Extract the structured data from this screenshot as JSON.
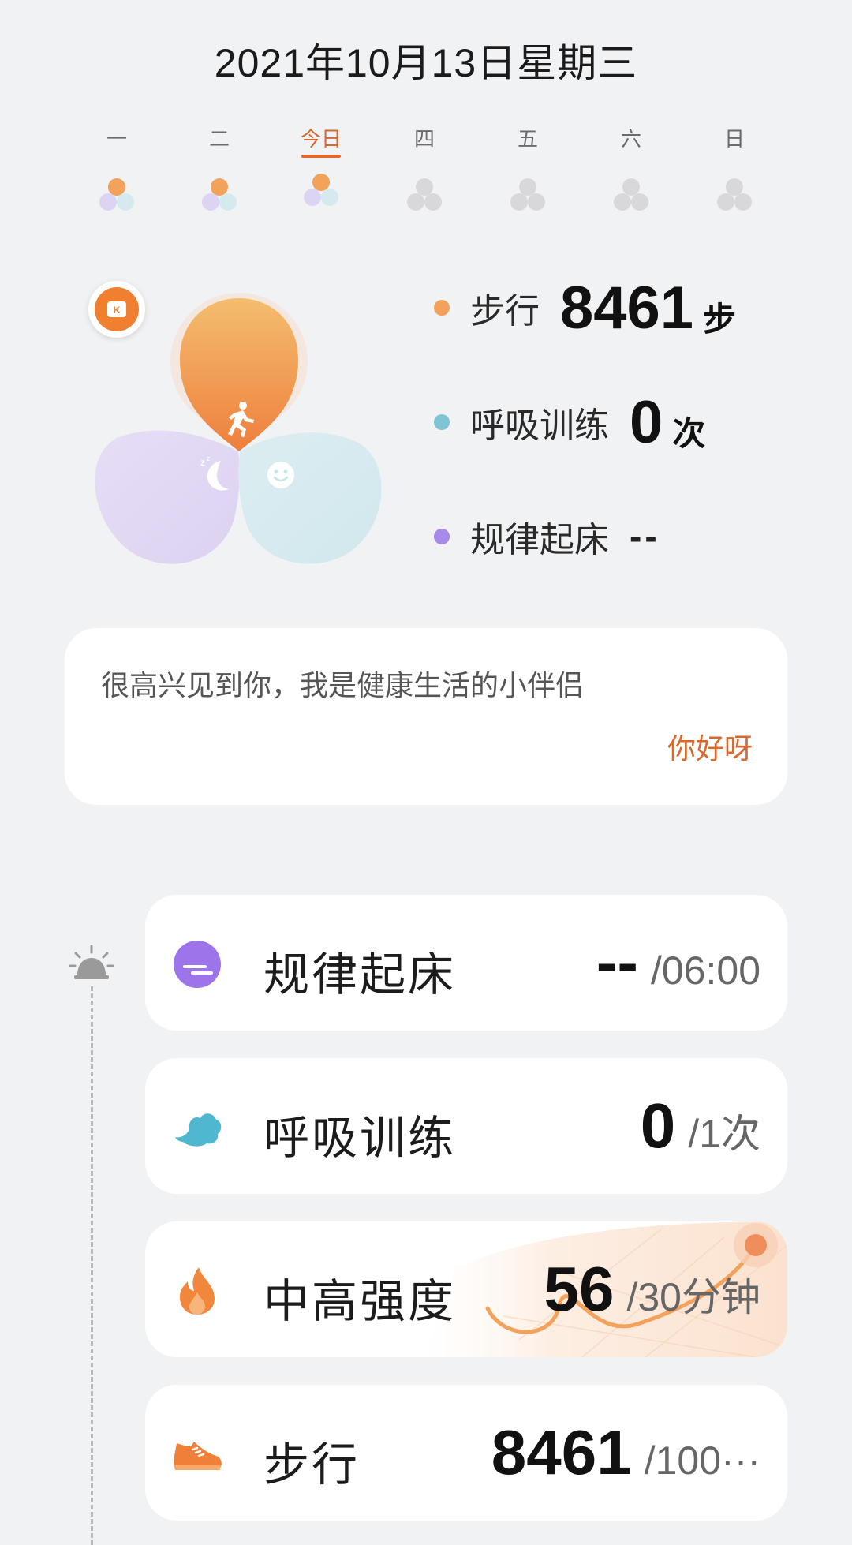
{
  "header": {
    "date": "2021年10月13日星期三"
  },
  "weekdays": [
    {
      "label": "一",
      "state": "done"
    },
    {
      "label": "二",
      "state": "done"
    },
    {
      "label": "今日",
      "state": "today"
    },
    {
      "label": "四",
      "state": "future"
    },
    {
      "label": "五",
      "state": "future"
    },
    {
      "label": "六",
      "state": "future"
    },
    {
      "label": "日",
      "state": "future"
    }
  ],
  "colors": {
    "accent": "#e2692b",
    "walk": "#f2a25a",
    "breath": "#7fc5d4",
    "wake": "#a88be8",
    "background": "#f1f2f4"
  },
  "summary": {
    "walk": {
      "label": "步行",
      "value": "8461",
      "unit": "步",
      "icon": "runner-icon"
    },
    "breath": {
      "label": "呼吸训练",
      "value": "0",
      "unit": "次",
      "icon": "smile-icon"
    },
    "wake": {
      "label": "规律起床",
      "value": "--",
      "icon": "moon-sleep-icon"
    }
  },
  "greeting": {
    "message": "很高兴见到你，我是健康生活的小伴侣",
    "action": "你好呀"
  },
  "tasks": [
    {
      "name": "规律起床",
      "value": "--",
      "goal": "/06:00",
      "icon": "sunrise-icon"
    },
    {
      "name": "呼吸训练",
      "value": "0",
      "goal": "/1次",
      "icon": "cloud-icon"
    },
    {
      "name": "中高强度",
      "value": "56",
      "goal": "/30分钟",
      "icon": "flame-icon"
    },
    {
      "name": "步行",
      "value": "8461",
      "goal": "/100···",
      "icon": "sneaker-icon"
    }
  ]
}
